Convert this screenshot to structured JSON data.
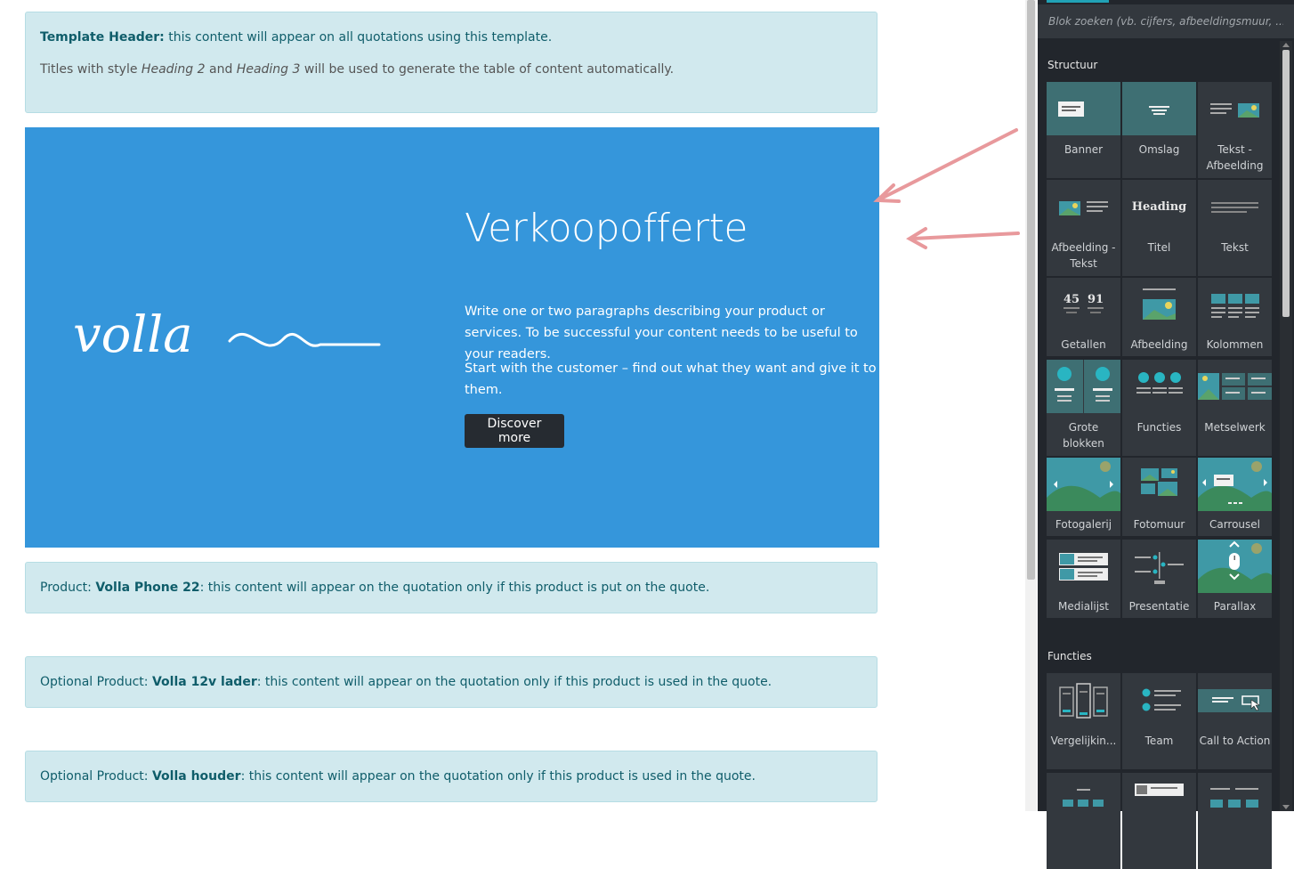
{
  "template_header": {
    "label": "Template Header:",
    "text": " this content will appear on all quotations using this template.",
    "line2_a": "Titles with style ",
    "line2_h2": "Heading 2",
    "line2_b": " and ",
    "line2_h3": "Heading 3",
    "line2_c": " will be used to generate the table of content automatically."
  },
  "banner": {
    "logo_text": "volla",
    "title": "Verkoopofferte",
    "paragraph1": "Write one or two paragraphs describing your product or services. To be successful your content needs to be useful to your readers.",
    "paragraph2": "Start with the customer – find out what they want and give it to them.",
    "button_label": "Discover more",
    "bg_color": "#3596db"
  },
  "product_notes": [
    {
      "prefix": "Product: ",
      "name": "Volla Phone 22",
      "suffix": ": this content will appear on the quotation only if this product is put on the quote."
    },
    {
      "prefix": "Optional Product: ",
      "name": "Volla 12v lader",
      "suffix": ": this content will appear on the quotation only if this product is used in the quote."
    },
    {
      "prefix": "Optional Product: ",
      "name": "Volla houder",
      "suffix": ": this content will appear on the quotation only if this product is used in the quote."
    }
  ],
  "panel": {
    "search_placeholder": "Blok zoeken (vb. cijfers, afbeeldingsmuur, ...)",
    "sections": [
      {
        "title": "Structuur",
        "tiles": [
          {
            "label": "Banner",
            "icon": "banner-icon"
          },
          {
            "label": "Omslag",
            "icon": "cover-icon"
          },
          {
            "label": "Tekst - Afbeelding",
            "icon": "text-image-icon"
          },
          {
            "label": "Afbeelding - Tekst",
            "icon": "image-text-icon"
          },
          {
            "label": "Titel",
            "icon": "heading-icon",
            "icon_text": "Heading"
          },
          {
            "label": "Tekst",
            "icon": "text-icon"
          },
          {
            "label": "Getallen",
            "icon": "numbers-icon",
            "icon_text_1": "45",
            "icon_text_2": "91"
          },
          {
            "label": "Afbeelding",
            "icon": "image-icon"
          },
          {
            "label": "Kolommen",
            "icon": "columns-icon"
          },
          {
            "label": "Grote blokken",
            "icon": "big-boxes-icon"
          },
          {
            "label": "Functies",
            "icon": "features-icon"
          },
          {
            "label": "Metselwerk",
            "icon": "masonry-icon"
          },
          {
            "label": "Fotogalerij",
            "icon": "gallery-icon"
          },
          {
            "label": "Fotomuur",
            "icon": "image-wall-icon"
          },
          {
            "label": "Carrousel",
            "icon": "carousel-icon"
          },
          {
            "label": "Medialijst",
            "icon": "media-list-icon"
          },
          {
            "label": "Presentatie",
            "icon": "showcase-icon"
          },
          {
            "label": "Parallax",
            "icon": "parallax-icon"
          }
        ]
      },
      {
        "title": "Functies",
        "tiles": [
          {
            "label": "Vergelijkin...",
            "icon": "comparisons-icon"
          },
          {
            "label": "Team",
            "icon": "team-icon"
          },
          {
            "label": "Call to Action",
            "icon": "call-to-action-icon"
          }
        ]
      }
    ]
  }
}
